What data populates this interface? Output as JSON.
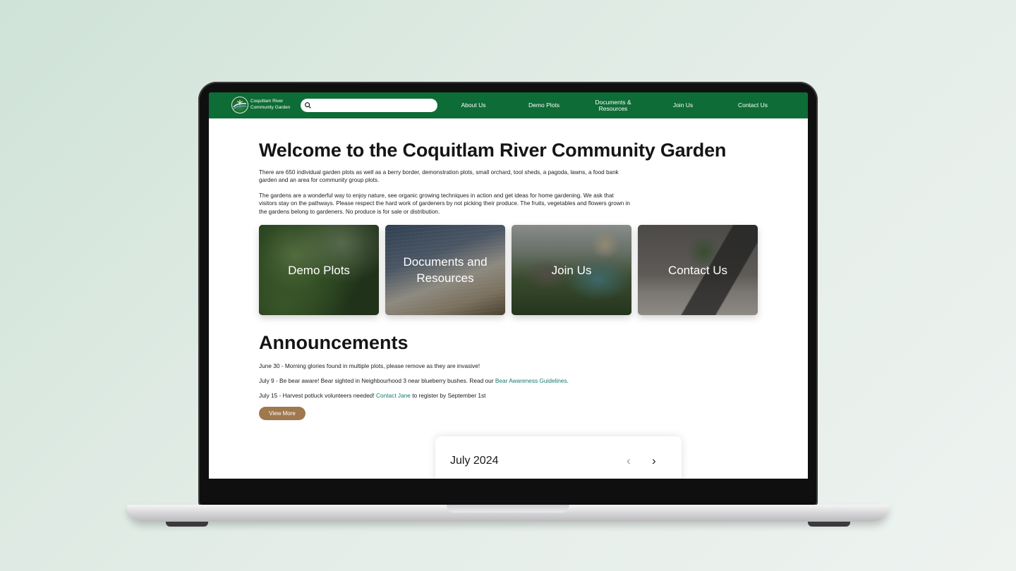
{
  "site": {
    "brand_line1": "Coquitlam River",
    "brand_line2": "Community Garden",
    "search_placeholder": "",
    "nav": [
      {
        "label": "About Us"
      },
      {
        "label": "Demo Plots"
      },
      {
        "label": "Documents & Resources"
      },
      {
        "label": "Join Us"
      },
      {
        "label": "Contact Us"
      }
    ]
  },
  "main": {
    "title": "Welcome to the Coquitlam River Community Garden",
    "intro1": "There are 650 individual garden plots as well as a berry border, demonstration plots, small orchard, tool sheds, a pagoda, lawns, a food bank garden and an area for community group plots.",
    "intro2": "The gardens are a wonderful way to enjoy nature, see organic growing techniques in action and get ideas for home gardening. We ask that visitors stay on the pathways. Please respect the hard work of gardeners by not picking their produce. The fruits, vegetables and flowers grown in the gardens belong to gardeners. No produce is for sale or distribution.",
    "cards": [
      {
        "label": "Demo Plots"
      },
      {
        "label": "Documents and Resources"
      },
      {
        "label": "Join Us"
      },
      {
        "label": "Contact Us"
      }
    ]
  },
  "announcements": {
    "title": "Announcements",
    "items": [
      {
        "text": "June 30 - Morning glories found in multiple plots, please remove as they are invasive!"
      },
      {
        "text": "July 9 - Be bear aware! Bear sighted in Neighbourhood 3 near blueberry bushes. Read our ",
        "link": "Bear Awareness Guidelines",
        "after": "."
      },
      {
        "text": "July 15 - Harvest potluck volunteers needed! ",
        "link": "Contact Jane",
        "after": " to register by September 1st"
      }
    ],
    "view_more": "View More"
  },
  "calendar": {
    "month": "July 2024",
    "prev_icon": "chevron-left-icon",
    "next_icon": "chevron-right-icon",
    "prev_glyph": "‹",
    "next_glyph": "›"
  },
  "colors": {
    "nav_green": "#0e6c36",
    "link_teal": "#137a6b",
    "button_brown": "#a0784e"
  }
}
